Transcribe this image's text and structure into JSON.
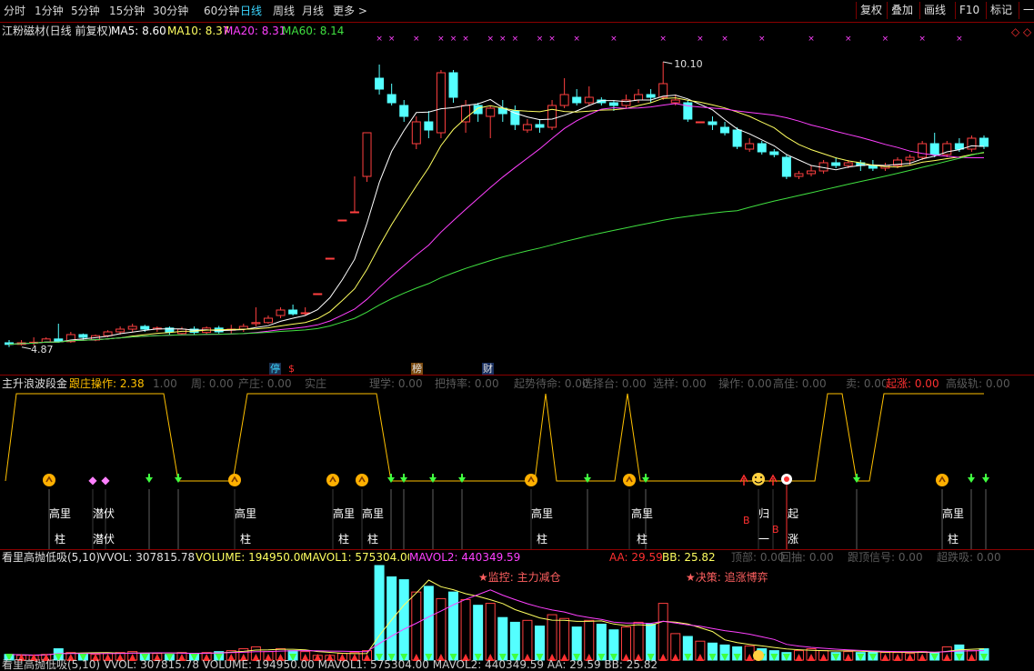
{
  "toolbar": {
    "periods": [
      "分时",
      "1分钟",
      "5分钟",
      "15分钟",
      "30分钟",
      "60分钟",
      "日线",
      "周线",
      "月线",
      "更多 >"
    ],
    "active_period": "日线",
    "right_buttons": [
      "复权",
      "叠加",
      "画线",
      "F10",
      "标记",
      "一自"
    ],
    "right_icon": "diamond-icon"
  },
  "main_panel": {
    "stock_title": "江粉磁材(日线 前复权)",
    "ma_legend": [
      {
        "name": "MA5",
        "value": "8.60",
        "color": "#ffffff"
      },
      {
        "name": "MA10",
        "value": "8.37",
        "color": "#ffff60"
      },
      {
        "name": "MA20",
        "value": "8.31",
        "color": "#ff40ff"
      },
      {
        "name": "MA60",
        "value": "8.14",
        "color": "#40e040"
      }
    ],
    "high_label": "10.10",
    "low_label": "4.87",
    "event_markers": [
      {
        "text": "停",
        "color": "#3ad6ff",
        "bg": "#1a3050"
      },
      {
        "text": "$",
        "color": "#ff3030",
        "bg": "#000000"
      },
      {
        "text": "榜",
        "color": "#e0e0e0",
        "bg": "#7a4a10"
      },
      {
        "text": "财",
        "color": "#e0e0e0",
        "bg": "#1a3060"
      }
    ]
  },
  "wave_panel": {
    "title": "主升浪波段金",
    "legend": [
      {
        "text": "跟庄操作: 2.38",
        "color": "#ffc000"
      },
      {
        "text": "起涨: 0.00",
        "color": "#ff3030"
      }
    ],
    "ghost_legend": [
      "1.00",
      "周: 0.00",
      "产庄: 0.00",
      "实庄",
      "理学: 0.00",
      "把持率: 0.00",
      "起势待命: 0.00",
      "选择台: 0.00",
      "选样: 0.00",
      "操作: 0.00",
      "高佳: 0.00",
      "卖: 0.00",
      "高级轨: 0.00"
    ],
    "signal_labels": [
      {
        "t1": "高里",
        "t2": "柱"
      },
      {
        "t1": "潜伏",
        "t2": "潜伏"
      },
      {
        "t1": "高里",
        "t2": "柱"
      },
      {
        "t1": "高里",
        "t2": "柱"
      },
      {
        "t1": "高里",
        "t2": "柱"
      },
      {
        "t1": "高里",
        "t2": "柱"
      },
      {
        "t1": "高里",
        "t2": "柱"
      },
      {
        "t1": "归",
        "t2": "一"
      },
      {
        "t1": "起",
        "t2": "涨"
      },
      {
        "t1": "高里",
        "t2": "柱"
      }
    ],
    "b_marks": [
      "B",
      "B"
    ]
  },
  "volume_panel": {
    "title": "看里高抛低吸(5,10)",
    "legend": [
      {
        "text": "VVOL: 307815.78",
        "color": "#e0e0e0"
      },
      {
        "text": "VOLUME: 194950.00",
        "color": "#ffff60"
      },
      {
        "text": "MAVOL1: 575304.00",
        "color": "#ffff60"
      },
      {
        "text": "MAVOL2: 440349.59",
        "color": "#ff40ff"
      },
      {
        "text": "AA: 29.59",
        "color": "#ff3030"
      },
      {
        "text": "BB: 25.82",
        "color": "#ffff60"
      }
    ],
    "ghost_legend": [
      "顶部: 0.00",
      "回抽: 0.00",
      "跟顶信号: 0.00",
      "超跌吸: 0.00"
    ],
    "annotations": [
      {
        "text": "★监控: 主力减仓",
        "color": "#ff6060"
      },
      {
        "text": "★决策: 追涨博弈",
        "color": "#ff6060"
      }
    ],
    "bottom_clipped": "看里高抛低吸(5,10) VVOL: 307815.78 VOLUME: 194950.00 MAVOL1: 575304.00 MAVOL2: 440349.59 AA: 29.59 BB: 25.82"
  },
  "chart_data": {
    "type": "candlestick",
    "y_range": [
      4.5,
      10.6
    ],
    "candles": [
      [
        4.95,
        4.92,
        5.0,
        4.87
      ],
      [
        4.92,
        4.95,
        5.0,
        4.9
      ],
      [
        4.95,
        4.96,
        5.05,
        4.9
      ],
      [
        4.96,
        5.02,
        5.05,
        4.95
      ],
      [
        5.02,
        4.97,
        5.3,
        4.95
      ],
      [
        4.97,
        5.1,
        5.15,
        4.95
      ],
      [
        5.1,
        5.05,
        5.12,
        5.0
      ],
      [
        5.0,
        5.08,
        5.1,
        4.98
      ],
      [
        5.08,
        5.15,
        5.18,
        5.05
      ],
      [
        5.15,
        5.2,
        5.25,
        5.1
      ],
      [
        5.2,
        5.25,
        5.3,
        5.15
      ],
      [
        5.25,
        5.2,
        5.28,
        5.15
      ],
      [
        5.2,
        5.22,
        5.25,
        5.15
      ],
      [
        5.22,
        5.15,
        5.25,
        5.1
      ],
      [
        5.12,
        5.2,
        5.24,
        5.1
      ],
      [
        5.2,
        5.14,
        5.25,
        5.1
      ],
      [
        5.14,
        5.22,
        5.25,
        5.1
      ],
      [
        5.22,
        5.15,
        5.26,
        5.12
      ],
      [
        5.18,
        5.2,
        5.28,
        5.12
      ],
      [
        5.2,
        5.25,
        5.3,
        5.15
      ],
      [
        5.3,
        5.32,
        5.6,
        5.25
      ],
      [
        5.32,
        5.4,
        5.45,
        5.3
      ],
      [
        5.45,
        5.55,
        5.6,
        5.4
      ],
      [
        5.55,
        5.48,
        5.65,
        5.45
      ],
      [
        5.5,
        5.5,
        5.6,
        5.45
      ],
      [
        5.85,
        5.85,
        5.85,
        5.85
      ],
      [
        6.5,
        6.5,
        6.5,
        6.5
      ],
      [
        7.2,
        7.2,
        7.2,
        7.2
      ],
      [
        7.35,
        7.35,
        8.0,
        7.35
      ],
      [
        8.0,
        8.8,
        8.8,
        7.9
      ],
      [
        9.8,
        9.6,
        10.05,
        9.5
      ],
      [
        9.5,
        9.35,
        9.7,
        9.3
      ],
      [
        9.3,
        9.1,
        9.4,
        9.0
      ],
      [
        8.6,
        9.0,
        9.1,
        8.5
      ],
      [
        9.0,
        8.85,
        9.2,
        8.7
      ],
      [
        8.8,
        9.9,
        9.95,
        8.7
      ],
      [
        9.9,
        9.45,
        9.95,
        9.35
      ],
      [
        9.0,
        9.3,
        9.4,
        8.8
      ],
      [
        9.3,
        9.15,
        9.35,
        9.0
      ],
      [
        9.1,
        9.25,
        9.3,
        8.7
      ],
      [
        9.25,
        9.15,
        9.4,
        9.0
      ],
      [
        9.2,
        8.95,
        9.3,
        8.85
      ],
      [
        8.85,
        8.95,
        9.05,
        8.8
      ],
      [
        8.95,
        8.9,
        9.05,
        8.8
      ],
      [
        8.9,
        9.3,
        9.4,
        8.85
      ],
      [
        9.3,
        9.5,
        9.8,
        9.25
      ],
      [
        9.45,
        9.35,
        9.6,
        9.3
      ],
      [
        9.35,
        9.45,
        9.65,
        9.3
      ],
      [
        9.4,
        9.35,
        9.45,
        9.3
      ],
      [
        9.35,
        9.3,
        9.4,
        9.2
      ],
      [
        9.3,
        9.4,
        9.5,
        9.25
      ],
      [
        9.4,
        9.5,
        9.6,
        9.35
      ],
      [
        9.5,
        9.45,
        9.6,
        9.35
      ],
      [
        9.45,
        9.7,
        10.1,
        9.4
      ],
      [
        9.35,
        9.4,
        9.5,
        9.3
      ],
      [
        9.35,
        9.05,
        9.4,
        9.0
      ],
      [
        9.0,
        9.0,
        9.0,
        9.0
      ],
      [
        9.0,
        8.95,
        9.1,
        8.85
      ],
      [
        8.9,
        8.8,
        9.0,
        8.75
      ],
      [
        8.85,
        8.55,
        8.9,
        8.5
      ],
      [
        8.5,
        8.6,
        8.7,
        8.45
      ],
      [
        8.6,
        8.45,
        8.65,
        8.4
      ],
      [
        8.45,
        8.4,
        8.5,
        8.35
      ],
      [
        8.35,
        8.0,
        8.4,
        7.95
      ],
      [
        8.0,
        8.05,
        8.1,
        7.95
      ],
      [
        8.05,
        8.1,
        8.2,
        8.0
      ],
      [
        8.1,
        8.25,
        8.3,
        8.05
      ],
      [
        8.25,
        8.2,
        8.35,
        8.15
      ],
      [
        8.2,
        8.25,
        8.3,
        8.15
      ],
      [
        8.25,
        8.2,
        8.3,
        8.1
      ],
      [
        8.2,
        8.15,
        8.3,
        8.1
      ],
      [
        8.15,
        8.2,
        8.25,
        8.1
      ],
      [
        8.2,
        8.3,
        8.35,
        8.15
      ],
      [
        8.3,
        8.35,
        8.4,
        8.2
      ],
      [
        8.35,
        8.6,
        8.65,
        8.3
      ],
      [
        8.6,
        8.4,
        8.8,
        8.35
      ],
      [
        8.4,
        8.6,
        8.65,
        8.35
      ],
      [
        8.6,
        8.5,
        8.7,
        8.45
      ],
      [
        8.5,
        8.7,
        8.75,
        8.45
      ],
      [
        8.7,
        8.55,
        8.75,
        8.5
      ]
    ],
    "volume": [
      6,
      5,
      5,
      6,
      12,
      8,
      7,
      6,
      7,
      8,
      9,
      7,
      7,
      6,
      8,
      7,
      8,
      9,
      10,
      12,
      14,
      9,
      12,
      10,
      9,
      5,
      5,
      7,
      8,
      10,
      100,
      88,
      85,
      72,
      78,
      65,
      72,
      64,
      58,
      60,
      45,
      40,
      42,
      36,
      48,
      44,
      35,
      42,
      38,
      32,
      35,
      40,
      38,
      60,
      28,
      25,
      20,
      18,
      16,
      14,
      15,
      12,
      10,
      8,
      10,
      12,
      10,
      8,
      9,
      8,
      9,
      8,
      8,
      7,
      9,
      8,
      14,
      16,
      10,
      12
    ]
  }
}
